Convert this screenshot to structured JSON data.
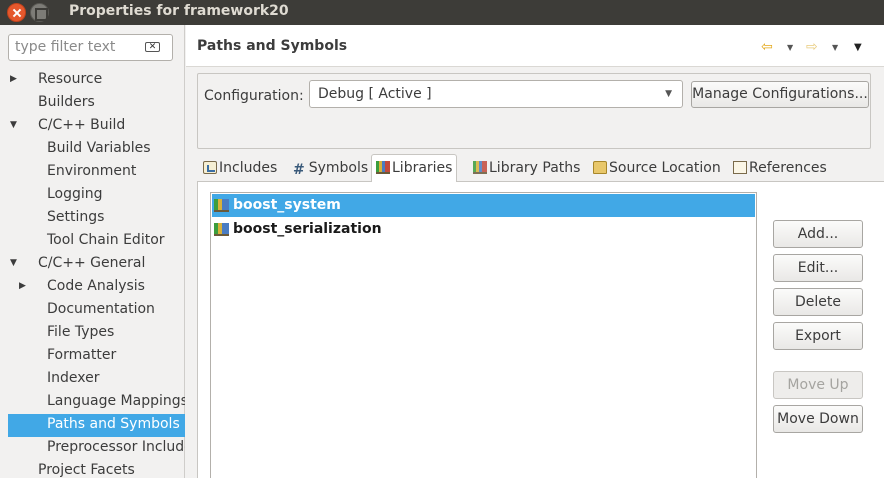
{
  "window": {
    "title": "Properties for framework20"
  },
  "filter": {
    "placeholder": "type filter text"
  },
  "tree": [
    {
      "label": "Resource",
      "level": 0,
      "expander": "collapsed"
    },
    {
      "label": "Builders",
      "level": 0,
      "expander": "none"
    },
    {
      "label": "C/C++ Build",
      "level": 0,
      "expander": "expanded"
    },
    {
      "label": "Build Variables",
      "level": 1,
      "expander": "none"
    },
    {
      "label": "Environment",
      "level": 1,
      "expander": "none"
    },
    {
      "label": "Logging",
      "level": 1,
      "expander": "none"
    },
    {
      "label": "Settings",
      "level": 1,
      "expander": "none"
    },
    {
      "label": "Tool Chain Editor",
      "level": 1,
      "expander": "none"
    },
    {
      "label": "C/C++ General",
      "level": 0,
      "expander": "expanded"
    },
    {
      "label": "Code Analysis",
      "level": 1,
      "expander": "collapsed"
    },
    {
      "label": "Documentation",
      "level": 1,
      "expander": "none"
    },
    {
      "label": "File Types",
      "level": 1,
      "expander": "none"
    },
    {
      "label": "Formatter",
      "level": 1,
      "expander": "none"
    },
    {
      "label": "Indexer",
      "level": 1,
      "expander": "none"
    },
    {
      "label": "Language Mappings",
      "level": 1,
      "expander": "none"
    },
    {
      "label": "Paths and Symbols",
      "level": 1,
      "expander": "none",
      "selected": true
    },
    {
      "label": "Preprocessor Include Paths",
      "level": 1,
      "expander": "none"
    },
    {
      "label": "Project Facets",
      "level": 0,
      "expander": "none"
    }
  ],
  "page": {
    "title": "Paths and Symbols"
  },
  "config": {
    "label": "Configuration:",
    "value": "Debug  [ Active ]",
    "manage_label": "Manage Configurations..."
  },
  "tabs": [
    {
      "label": "Includes",
      "icon": "includes-icon"
    },
    {
      "label": "Symbols",
      "icon": "hash-icon"
    },
    {
      "label": "Libraries",
      "icon": "library-icon",
      "active": true
    },
    {
      "label": "Library Paths",
      "icon": "library-path-icon"
    },
    {
      "label": "Source Location",
      "icon": "folder-icon"
    },
    {
      "label": "References",
      "icon": "references-icon"
    }
  ],
  "libraries": [
    {
      "name": "boost_system",
      "selected": true
    },
    {
      "name": "boost_serialization"
    }
  ],
  "buttons": {
    "add": "Add...",
    "edit": "Edit...",
    "delete": "Delete",
    "export": "Export",
    "move_up": "Move Up",
    "move_down": "Move Down"
  },
  "colors": {
    "selection": "#41a8e6",
    "titlebar": "#3d3c38",
    "close": "#e5582d"
  }
}
